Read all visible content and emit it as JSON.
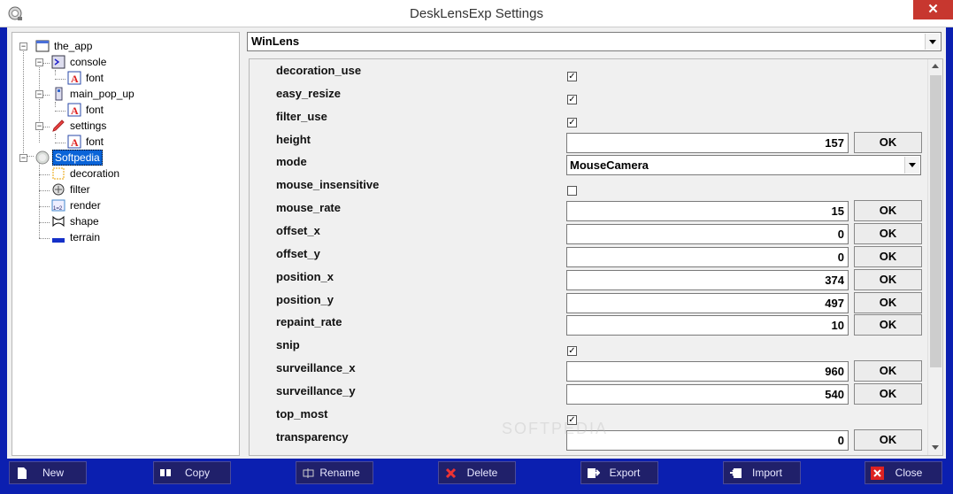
{
  "window": {
    "title": "DeskLensExp Settings",
    "close_glyph": "✕"
  },
  "tree": {
    "nodes": [
      {
        "label": "the_app",
        "icon": "app-window-icon"
      },
      {
        "label": "console",
        "icon": "console-icon"
      },
      {
        "label": "font",
        "icon": "font-icon"
      },
      {
        "label": "main_pop_up",
        "icon": "popup-icon"
      },
      {
        "label": "font",
        "icon": "font-icon"
      },
      {
        "label": "settings",
        "icon": "pen-icon"
      },
      {
        "label": "font",
        "icon": "font-icon"
      },
      {
        "label": "Softpedia",
        "icon": "lens-icon",
        "selected": true
      },
      {
        "label": "decoration",
        "icon": "decoration-icon"
      },
      {
        "label": "filter",
        "icon": "filter-icon"
      },
      {
        "label": "render",
        "icon": "render-icon"
      },
      {
        "label": "shape",
        "icon": "shape-icon"
      },
      {
        "label": "terrain",
        "icon": "terrain-icon"
      }
    ]
  },
  "class_select": {
    "value": "WinLens"
  },
  "props": {
    "ok_label": "OK",
    "check_glyph": "✓",
    "items": [
      {
        "name": "decoration_use",
        "kind": "check",
        "checked": true
      },
      {
        "name": "easy_resize",
        "kind": "check",
        "checked": true
      },
      {
        "name": "filter_use",
        "kind": "check",
        "checked": true
      },
      {
        "name": "height",
        "kind": "num",
        "value": "157"
      },
      {
        "name": "mode",
        "kind": "select",
        "value": "MouseCamera"
      },
      {
        "name": "mouse_insensitive",
        "kind": "check",
        "checked": false
      },
      {
        "name": "mouse_rate",
        "kind": "num",
        "value": "15"
      },
      {
        "name": "offset_x",
        "kind": "num",
        "value": "0"
      },
      {
        "name": "offset_y",
        "kind": "num",
        "value": "0"
      },
      {
        "name": "position_x",
        "kind": "num",
        "value": "374"
      },
      {
        "name": "position_y",
        "kind": "num",
        "value": "497"
      },
      {
        "name": "repaint_rate",
        "kind": "num",
        "value": "10"
      },
      {
        "name": "snip",
        "kind": "check",
        "checked": true
      },
      {
        "name": "surveillance_x",
        "kind": "num",
        "value": "960"
      },
      {
        "name": "surveillance_y",
        "kind": "num",
        "value": "540"
      },
      {
        "name": "top_most",
        "kind": "check",
        "checked": true
      },
      {
        "name": "transparency",
        "kind": "num",
        "value": "0"
      }
    ]
  },
  "buttons": {
    "new": "New",
    "copy": "Copy",
    "rename": "Rename",
    "delete": "Delete",
    "export": "Export",
    "import": "Import",
    "close": "Close"
  },
  "watermark": "SOFTPEDIA",
  "colors": {
    "frame": "#0b1fb0",
    "selection": "#0a64d8",
    "close": "#c7372f"
  }
}
